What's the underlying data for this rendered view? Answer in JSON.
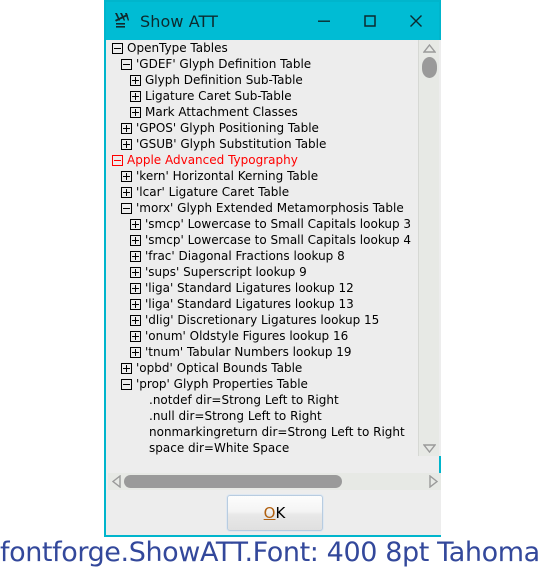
{
  "window": {
    "title": "Show ATT",
    "icon": "fontforge-att-icon",
    "border_color": "#00b5cc",
    "titlebar_color": "#00bcd4",
    "controls": [
      {
        "name": "minimize",
        "glyph": "minimize-icon"
      },
      {
        "name": "maximize",
        "glyph": "maximize-icon"
      },
      {
        "name": "close",
        "glyph": "close-icon"
      }
    ]
  },
  "tree": {
    "rows": [
      {
        "indent": 0,
        "toggle": "minus",
        "label": "OpenType Tables",
        "color": "black"
      },
      {
        "indent": 1,
        "toggle": "minus",
        "label": "'GDEF' Glyph Definition Table",
        "color": "black"
      },
      {
        "indent": 2,
        "toggle": "plus",
        "label": "Glyph Definition Sub-Table",
        "color": "black"
      },
      {
        "indent": 2,
        "toggle": "plus",
        "label": "Ligature Caret Sub-Table",
        "color": "black"
      },
      {
        "indent": 2,
        "toggle": "plus",
        "label": "Mark Attachment Classes",
        "color": "black"
      },
      {
        "indent": 1,
        "toggle": "plus",
        "label": "'GPOS' Glyph Positioning Table",
        "color": "black"
      },
      {
        "indent": 1,
        "toggle": "plus",
        "label": "'GSUB' Glyph Substitution Table",
        "color": "black"
      },
      {
        "indent": 0,
        "toggle": "minus",
        "label": "Apple Advanced Typography",
        "color": "red"
      },
      {
        "indent": 1,
        "toggle": "plus",
        "label": "'kern' Horizontal Kerning Table",
        "color": "black"
      },
      {
        "indent": 1,
        "toggle": "plus",
        "label": "'lcar' Ligature Caret Table",
        "color": "black"
      },
      {
        "indent": 1,
        "toggle": "minus",
        "label": "'morx' Glyph Extended Metamorphosis Table",
        "color": "black"
      },
      {
        "indent": 2,
        "toggle": "plus",
        "label": "'smcp' Lowercase to Small Capitals lookup 3",
        "color": "black"
      },
      {
        "indent": 2,
        "toggle": "plus",
        "label": "'smcp' Lowercase to Small Capitals lookup 4",
        "color": "black"
      },
      {
        "indent": 2,
        "toggle": "plus",
        "label": "'frac' Diagonal Fractions lookup 8",
        "color": "black"
      },
      {
        "indent": 2,
        "toggle": "plus",
        "label": "'sups' Superscript lookup 9",
        "color": "black"
      },
      {
        "indent": 2,
        "toggle": "plus",
        "label": "'liga' Standard Ligatures lookup 12",
        "color": "black"
      },
      {
        "indent": 2,
        "toggle": "plus",
        "label": "'liga' Standard Ligatures lookup 13",
        "color": "black"
      },
      {
        "indent": 2,
        "toggle": "plus",
        "label": "'dlig' Discretionary Ligatures lookup 15",
        "color": "black"
      },
      {
        "indent": 2,
        "toggle": "plus",
        "label": "'onum' Oldstyle Figures lookup 16",
        "color": "black"
      },
      {
        "indent": 2,
        "toggle": "plus",
        "label": "'tnum' Tabular Numbers lookup 19",
        "color": "black"
      },
      {
        "indent": 1,
        "toggle": "plus",
        "label": "'opbd' Optical Bounds Table",
        "color": "black"
      },
      {
        "indent": 1,
        "toggle": "minus",
        "label": "'prop' Glyph Properties Table",
        "color": "black"
      },
      {
        "indent": 2,
        "toggle": "none",
        "label": ".notdef  dir=Strong Left to Right",
        "color": "black"
      },
      {
        "indent": 2,
        "toggle": "none",
        "label": ".null  dir=Strong Left to Right",
        "color": "black"
      },
      {
        "indent": 2,
        "toggle": "none",
        "label": "nonmarkingreturn  dir=Strong Left to Right",
        "color": "black"
      },
      {
        "indent": 2,
        "toggle": "none",
        "label": "space  dir=White Space",
        "color": "black"
      }
    ]
  },
  "scrollbars": {
    "vertical": {
      "up_icon": "triangle-up-icon",
      "down_icon": "triangle-down-icon",
      "thumb": "vertical-thumb"
    },
    "horizontal": {
      "left_icon": "triangle-left-icon",
      "right_icon": "triangle-right-icon",
      "thumb": "horizontal-thumb"
    }
  },
  "buttons": {
    "ok_mnemonic": "O",
    "ok_rest": "K"
  },
  "caption": {
    "text": "fontforge.ShowATT.Font: 400 8pt Tahoma",
    "color": "#33489b"
  }
}
